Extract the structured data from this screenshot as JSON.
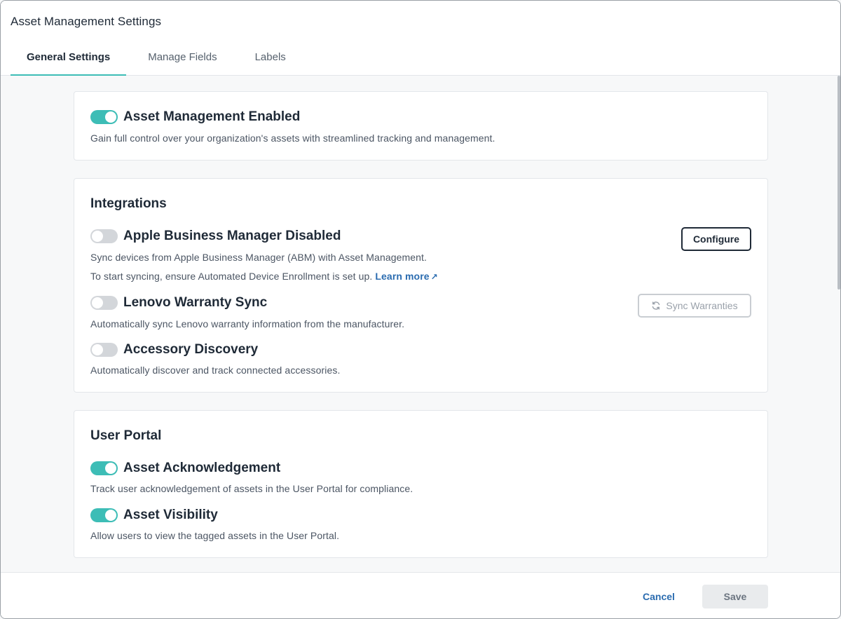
{
  "window": {
    "title": "Asset Management Settings"
  },
  "tabs": [
    {
      "label": "General Settings",
      "active": true
    },
    {
      "label": "Manage Fields",
      "active": false
    },
    {
      "label": "Labels",
      "active": false
    }
  ],
  "asset_management": {
    "title": "Asset Management Enabled",
    "enabled": true,
    "description": "Gain full control over your organization's assets with streamlined tracking and management."
  },
  "integrations": {
    "heading": "Integrations",
    "apple": {
      "title": "Apple Business Manager Disabled",
      "enabled": false,
      "description": "Sync devices from Apple Business Manager (ABM) with Asset Management.",
      "note": "To start syncing, ensure Automated Device Enrollment is set up.",
      "learn_more": "Learn more",
      "configure_label": "Configure"
    },
    "lenovo": {
      "title": "Lenovo Warranty Sync",
      "enabled": false,
      "description": "Automatically sync Lenovo warranty information from the manufacturer.",
      "sync_label": "Sync Warranties"
    },
    "accessory": {
      "title": "Accessory Discovery",
      "enabled": false,
      "description": "Automatically discover and track connected accessories."
    }
  },
  "user_portal": {
    "heading": "User Portal",
    "acknowledgement": {
      "title": "Asset Acknowledgement",
      "enabled": true,
      "description": "Track user acknowledgement of assets in the User Portal for compliance."
    },
    "visibility": {
      "title": "Asset Visibility",
      "enabled": true,
      "description": "Allow users to view the tagged assets in the User Portal."
    }
  },
  "footer": {
    "cancel_label": "Cancel",
    "save_label": "Save"
  },
  "colors": {
    "accent": "#3dbdb6",
    "link": "#2b6cb0",
    "toggle_off": "#d3d6da"
  }
}
